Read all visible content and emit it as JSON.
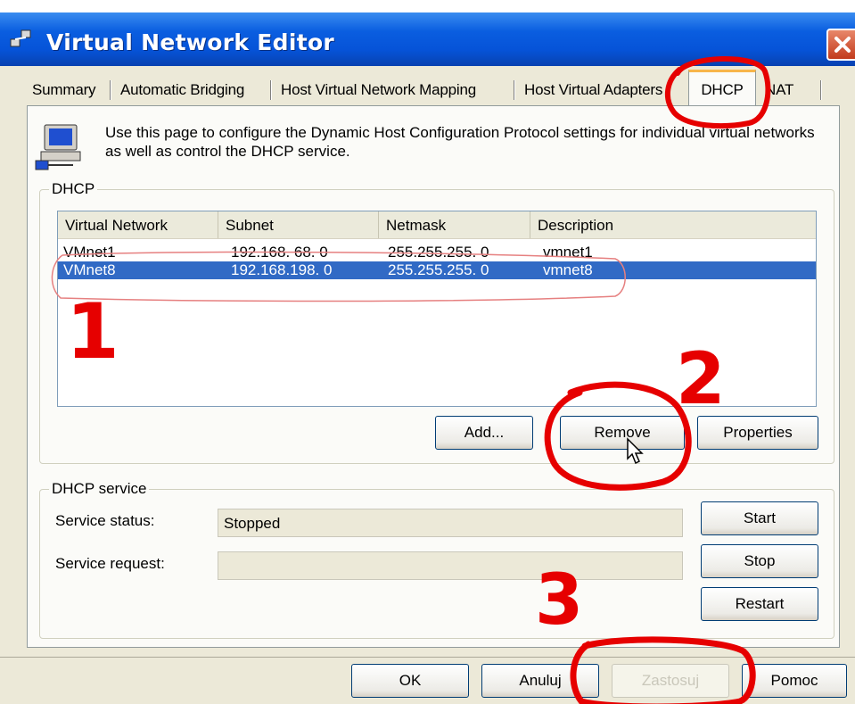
{
  "window": {
    "title": "Virtual Network Editor"
  },
  "tabs": [
    {
      "label": "Summary"
    },
    {
      "label": "Automatic Bridging"
    },
    {
      "label": "Host Virtual Network Mapping"
    },
    {
      "label": "Host Virtual Adapters"
    },
    {
      "label": "DHCP"
    },
    {
      "label": "NAT"
    }
  ],
  "intro": {
    "text": "Use this page to configure the Dynamic Host Configuration Protocol settings for individual virtual networks as well as control the DHCP service."
  },
  "dhcp_group": {
    "legend": "DHCP",
    "columns": [
      "Virtual Network",
      "Subnet",
      "Netmask",
      "Description"
    ],
    "rows": [
      {
        "network": "VMnet1",
        "subnet": "192.168. 68.  0",
        "netmask": "255.255.255.  0",
        "description": "vmnet1"
      },
      {
        "network": "VMnet8",
        "subnet": "192.168.198.  0",
        "netmask": "255.255.255.  0",
        "description": "vmnet8"
      }
    ],
    "selected_row": 1,
    "buttons": {
      "add": "Add...",
      "remove": "Remove",
      "properties": "Properties"
    }
  },
  "service_group": {
    "legend": "DHCP service",
    "status_label": "Service status:",
    "status_value": "Stopped",
    "request_label": "Service request:",
    "request_value": "",
    "buttons": {
      "start": "Start",
      "stop": "Stop",
      "restart": "Restart"
    }
  },
  "dialog_buttons": {
    "ok": "OK",
    "cancel": "Anuluj",
    "apply": "Zastosuj",
    "help": "Pomoc"
  },
  "annotations": {
    "one": "1",
    "two": "2",
    "three": "3",
    "color": "#e60000"
  },
  "colors": {
    "titlebar": "#0653d8",
    "selection": "#316ac5",
    "tab_highlight": "#f7b54a"
  }
}
